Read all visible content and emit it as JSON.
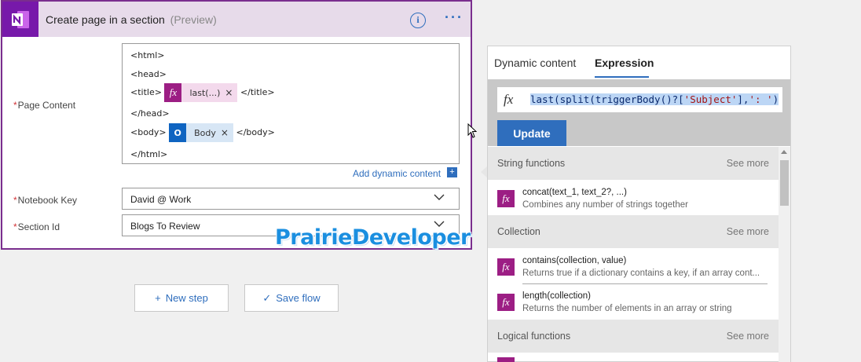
{
  "card": {
    "title": "Create page in a section",
    "preview_label": "(Preview)",
    "info_icon": "info-icon",
    "more_icon": "ellipsis-icon",
    "brand_color": "#7719aa"
  },
  "fields": {
    "page_content_label": "Page Content",
    "notebook_key_label": "Notebook Key",
    "section_id_label": "Section Id",
    "required_marker": "*"
  },
  "editor": {
    "line_html_open": "<html>",
    "line_head_open": "<head>",
    "line_title_open": "<title>",
    "expr_token_label": "last(...)",
    "line_title_close": "</title>",
    "line_head_close": "</head>",
    "line_body_open": "<body>",
    "body_token_label": "Body",
    "line_body_close": "</body>",
    "line_html_close": "</html>",
    "token_close": "×"
  },
  "add_dynamic_content": "Add dynamic content",
  "add_dynamic_plus": "+",
  "notebook_key_value": "David @ Work",
  "section_id_value": "Blogs To Review",
  "buttons": {
    "new_step": "New step",
    "new_step_glyph": "+",
    "save_flow": "Save flow",
    "save_flow_glyph": "✓"
  },
  "watermark": "PrairieDeveloper",
  "panel": {
    "tab_dynamic": "Dynamic content",
    "tab_expression": "Expression",
    "fx_symbol": "fx",
    "expr_prefix": "last(split(triggerBody()?[",
    "expr_str1": "'Subject'",
    "expr_mid": "],",
    "expr_str2": "': '",
    "expr_suffix": ")",
    "update_label": "Update",
    "accent": "#2f6ebd"
  },
  "sections": {
    "string_functions": "String functions",
    "collection": "Collection",
    "logical_functions": "Logical functions",
    "see_more": "See more"
  },
  "functions": [
    {
      "name": "concat(text_1, text_2?, ...)",
      "desc": "Combines any number of strings together"
    },
    {
      "name": "contains(collection, value)",
      "desc": "Returns true if a dictionary contains a key, if an array cont..."
    },
    {
      "name": "length(collection)",
      "desc": "Returns the number of elements in an array or string"
    }
  ]
}
